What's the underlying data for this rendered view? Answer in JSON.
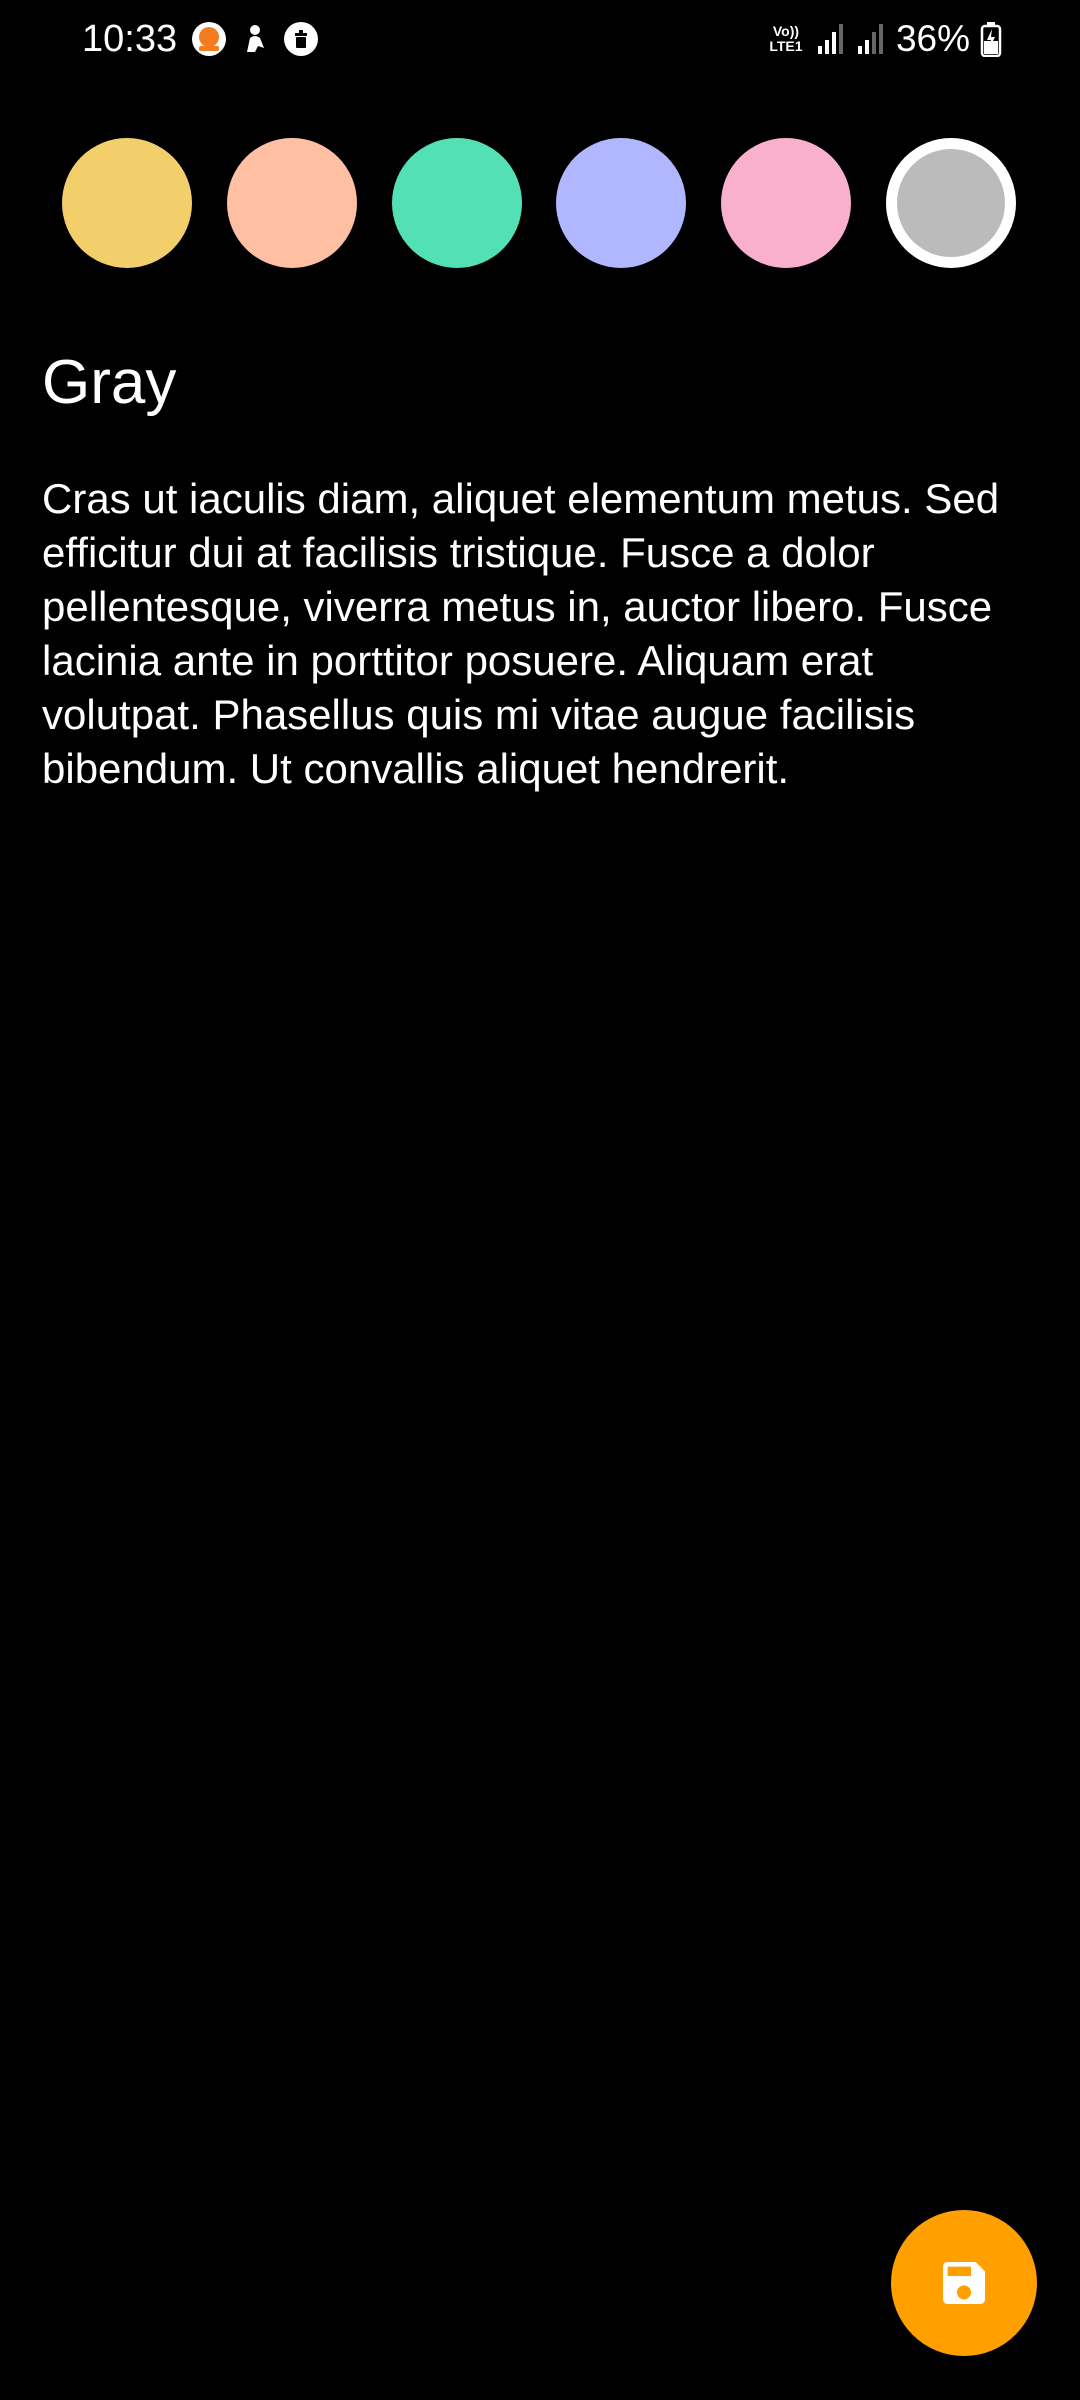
{
  "status_bar": {
    "time": "10:33",
    "network_label": "Vo)) LTE1",
    "battery": "36%",
    "notification_icons": [
      "app-notification-icon",
      "person-notification-icon",
      "delete-notification-icon"
    ]
  },
  "palette": {
    "colors": [
      {
        "name": "yellow",
        "hex": "#F2CF6A"
      },
      {
        "name": "peach",
        "hex": "#FFBFA3"
      },
      {
        "name": "green",
        "hex": "#53E0B5"
      },
      {
        "name": "lavender",
        "hex": "#B1B7FE"
      },
      {
        "name": "pink",
        "hex": "#F8B0CC"
      },
      {
        "name": "gray",
        "hex": "#BBBBBB"
      }
    ],
    "selected": "gray"
  },
  "note": {
    "title": "Gray",
    "body": "Cras ut iaculis diam, aliquet elementum metus. Sed efficitur dui at facilisis tristique. Fusce a dolor pellentesque, viverra metus in, auctor libero. Fusce lacinia ante in porttitor posuere. Aliquam erat volutpat. Phasellus quis mi vitae augue facilisis bibendum. Ut convallis aliquet hendrerit."
  },
  "fab": {
    "icon": "save-icon",
    "color": "#FFA000"
  }
}
